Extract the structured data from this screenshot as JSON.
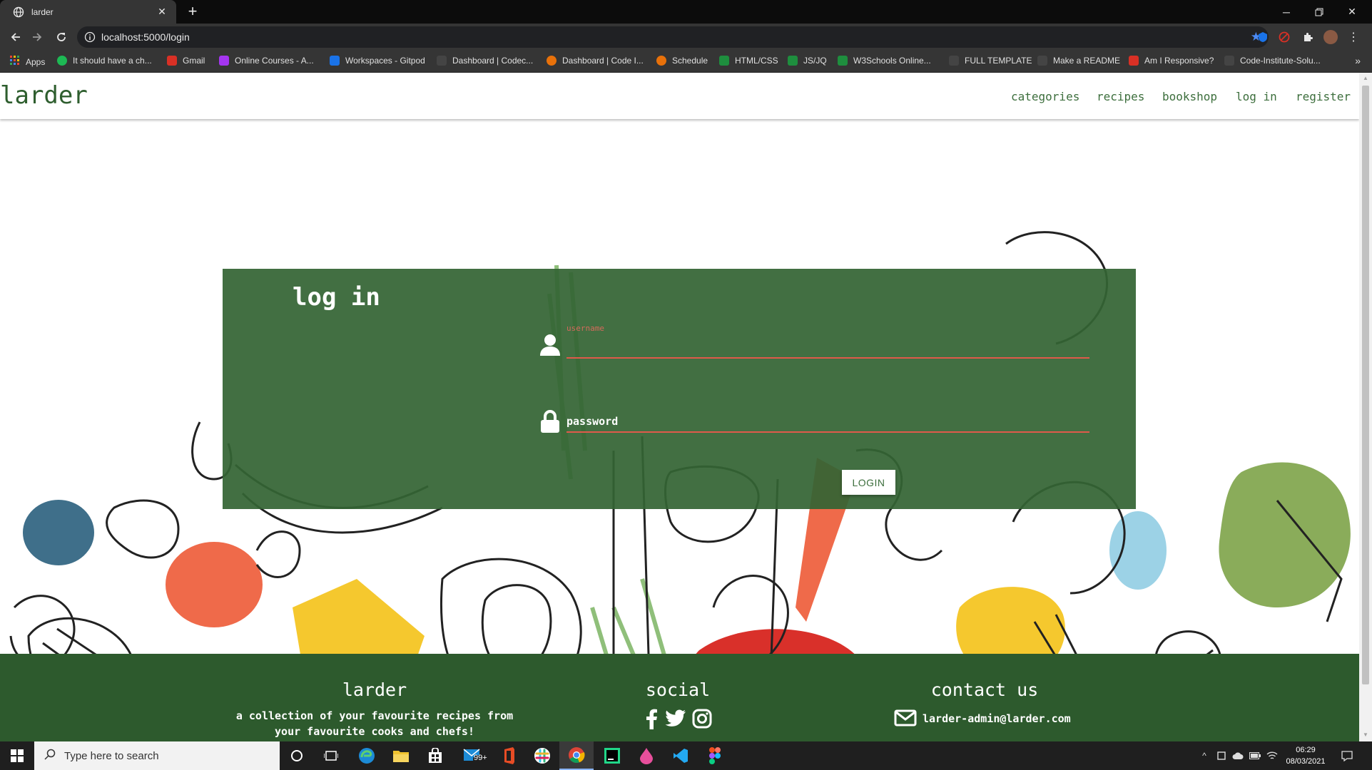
{
  "browser": {
    "tab_title": "larder",
    "url": "localhost:5000/login",
    "bookmarks": [
      {
        "label": "Apps",
        "color": "#ea4335"
      },
      {
        "label": "It should have a ch...",
        "color": "#1db954"
      },
      {
        "label": "Gmail",
        "color": "#d93025"
      },
      {
        "label": "Online Courses - A...",
        "color": "#a435f0"
      },
      {
        "label": "Workspaces - Gitpod",
        "color": "#1a73e8"
      },
      {
        "label": "Dashboard | Codec...",
        "color": "#444444"
      },
      {
        "label": "Dashboard | Code I...",
        "color": "#e8710a"
      },
      {
        "label": "Schedule",
        "color": "#e8710a"
      },
      {
        "label": "HTML/CSS",
        "color": "#1e8e3e"
      },
      {
        "label": "JS/JQ",
        "color": "#1e8e3e"
      },
      {
        "label": "W3Schools Online...",
        "color": "#1e8e3e"
      },
      {
        "label": "FULL TEMPLATE",
        "color": "#444444"
      },
      {
        "label": "Make a README",
        "color": "#444444"
      },
      {
        "label": "Am I Responsive?",
        "color": "#d93025"
      },
      {
        "label": "Code-Institute-Solu...",
        "color": "#444444"
      }
    ],
    "bookmarks_more": "»"
  },
  "site": {
    "brand": "larder",
    "nav": [
      "categories",
      "recipes",
      "bookshop",
      "log in",
      "register"
    ]
  },
  "login": {
    "title": "log in",
    "username_label": "username",
    "password_placeholder": "password",
    "submit_label": "LOGIN"
  },
  "footer": {
    "about_title": "larder",
    "about_text_line1": "a collection of your favourite recipes from",
    "about_text_line2": "your favourite cooks and chefs!",
    "social_title": "social",
    "social_icons": [
      "facebook-icon",
      "twitter-icon",
      "instagram-icon"
    ],
    "contact_title": "contact us",
    "email": "larder-admin@larder.com"
  },
  "taskbar": {
    "search_placeholder": "Type here to search",
    "mail_badge": "99+",
    "time": "06:29",
    "date": "08/03/2021"
  },
  "colors": {
    "brand_green": "#2e5e2e",
    "card_green": "#346434",
    "accent_red": "#e05a4a"
  }
}
